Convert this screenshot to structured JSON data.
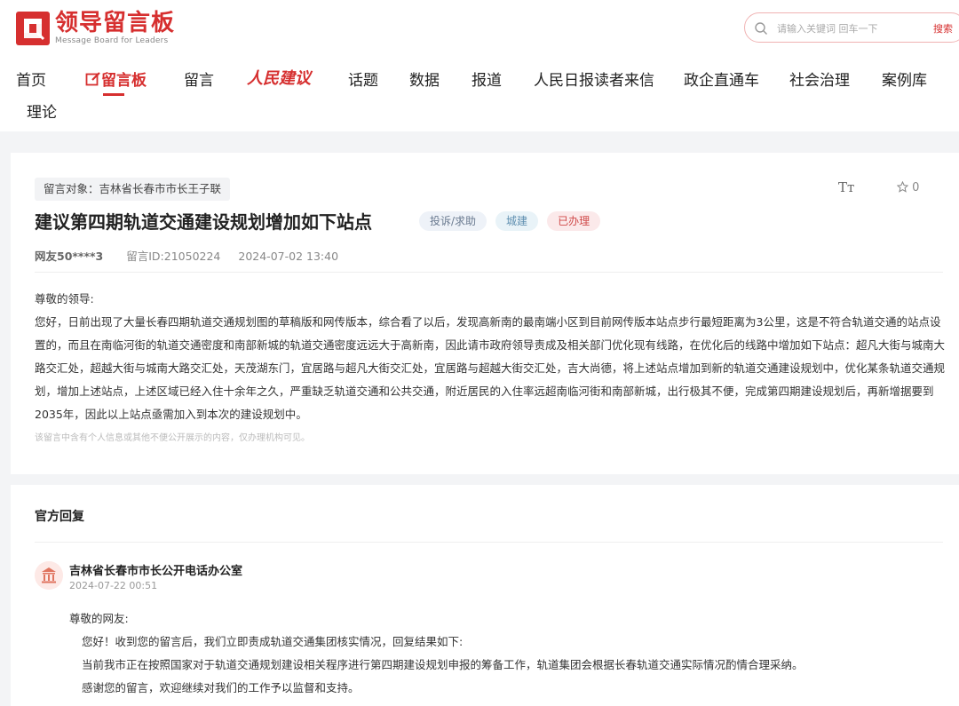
{
  "brand": {
    "name_cn": "领导留言板",
    "name_en": "Message Board for Leaders"
  },
  "search": {
    "placeholder": "请输入关键词 回车一下",
    "button": "搜索"
  },
  "nav": {
    "items": [
      "首页",
      "留言板",
      "留言",
      "人民建议",
      "话题",
      "数据",
      "报道",
      "人民日报读者来信",
      "政企直通车",
      "社会治理",
      "案例库",
      "理论"
    ],
    "active": "留言板"
  },
  "message": {
    "target_label": "留言对象：吉林省长春市市长王子联",
    "font_button": "Tт",
    "fav_count": "0",
    "title": "建议第四期轨道交通建设规划增加如下站点",
    "tags": [
      "投诉/求助",
      "城建",
      "已办理"
    ],
    "author": "网友50****3",
    "message_id": "留言ID:21050224",
    "datetime": "2024-07-02 13:40",
    "greeting": "尊敬的领导:",
    "body": "您好，日前出现了大量长春四期轨道交通规划图的草稿版和网传版本，综合看了以后，发现高新南的最南端小区到目前网传版本站点步行最短距离为3公里，这是不符合轨道交通的站点设置的，而且在南临河街的轨道交通密度和南部新城的轨道交通密度远远大于高新南，因此请市政府领导责成及相关部门优化现有线路，在优化后的线路中增加如下站点：超凡大街与城南大路交汇处，超越大街与城南大路交汇处，天茂湖东门，宜居路与超凡大街交汇处，宜居路与超越大街交汇处，吉大尚德，将上述站点增加到新的轨道交通建设规划中，优化某条轨道交通规划，增加上述站点，上述区域已经入住十余年之久，严重缺乏轨道交通和公共交通，附近居民的入住率远超南临河街和南部新城，出行极其不便，完成第四期建设规划后，再新增据要到2035年，因此以上站点亟需加入到本次的建设规划中。",
    "privacy_notice": "该留言中含有个人信息或其他不便公开展示的内容，仅办理机构可见。"
  },
  "reply": {
    "heading": "官方回复",
    "org": "吉林省长春市市长公开电话办公室",
    "datetime": "2024-07-22 00:51",
    "greeting": "尊敬的网友:",
    "lines": [
      "您好！收到您的留言后，我们立即责成轨道交通集团核实情况，回复结果如下:",
      "当前我市正在按照国家对于轨道交通规划建设相关程序进行第四期建设规划申报的筹备工作，轨道集团会根据长春轨道交通实际情况酌情合理采纳。",
      "感谢您的留言，欢迎继续对我们的工作予以监督和支持。"
    ]
  },
  "colors": {
    "brand_red": "#d62f2f",
    "page_bg": "#f3f4f6"
  }
}
